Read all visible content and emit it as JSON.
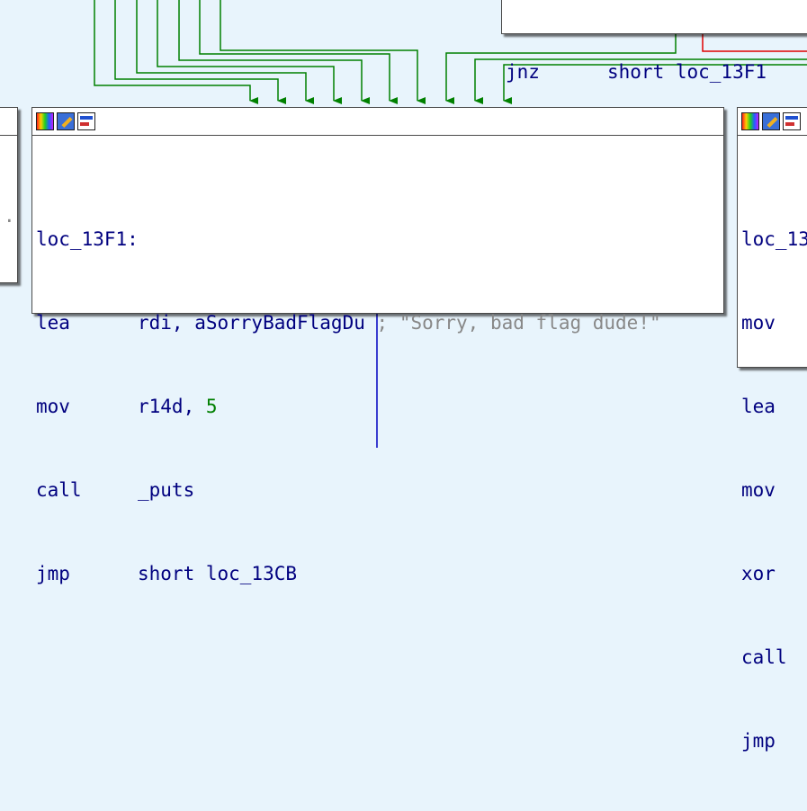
{
  "colors": {
    "background": "#e8f4fc",
    "true_edge": "#008000",
    "false_edge": "#e00000",
    "plain_edge": "#0000c0"
  },
  "header_icons": [
    "color-palette-icon",
    "rename-edit-icon",
    "graph-overview-icon"
  ],
  "top_node": {
    "mnemonic": "jnz",
    "operand": "short loc_13F1"
  },
  "center_node": {
    "label": "loc_13F1:",
    "lines": [
      {
        "mnemonic": "lea",
        "operand": "rdi, aSorryBadFlagDu",
        "comment": "; \"Sorry, bad flag dude!\""
      },
      {
        "mnemonic": "mov",
        "reg": "r14d, ",
        "num": "5"
      },
      {
        "mnemonic": "call",
        "operand": "_puts"
      },
      {
        "mnemonic": "jmp",
        "operand": "short loc_13CB"
      }
    ]
  },
  "right_node": {
    "label": "loc_13",
    "mnemonics": [
      "mov",
      "lea",
      "mov",
      "xor",
      "call",
      "jmp"
    ]
  },
  "left_node": {
    "fragment": "."
  }
}
